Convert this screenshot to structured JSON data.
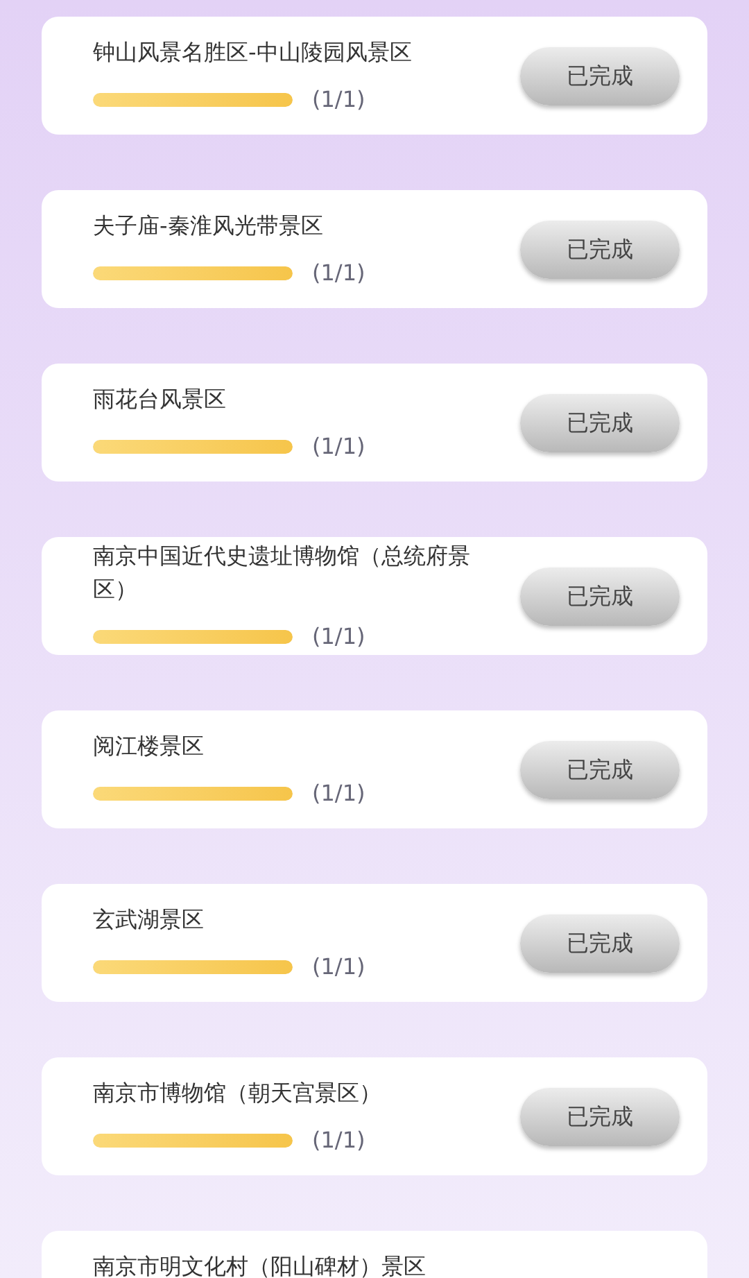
{
  "tasks": [
    {
      "title": "钟山风景名胜区-中山陵园风景区",
      "level": 1,
      "progress": "(1/1)",
      "button": "已完成"
    },
    {
      "title": "夫子庙-秦淮风光带景区",
      "level": 1,
      "progress": "(1/1)",
      "button": "已完成"
    },
    {
      "title": "雨花台风景区",
      "level": 1,
      "progress": "(1/1)",
      "button": "已完成"
    },
    {
      "title": "南京中国近代史遗址博物馆（总统府景区）",
      "level": 1,
      "progress": "(1/1)",
      "button": "已完成"
    },
    {
      "title": "阅江楼景区",
      "level": 1,
      "progress": "(1/1)",
      "button": "已完成"
    },
    {
      "title": "玄武湖景区",
      "level": 1,
      "progress": "(1/1)",
      "button": "已完成"
    },
    {
      "title": "南京市博物馆（朝天宫景区）",
      "level": 1,
      "progress": "(1/1)",
      "button": "已完成"
    },
    {
      "title": "南京市明文化村（阳山碑材）景区"
    }
  ]
}
